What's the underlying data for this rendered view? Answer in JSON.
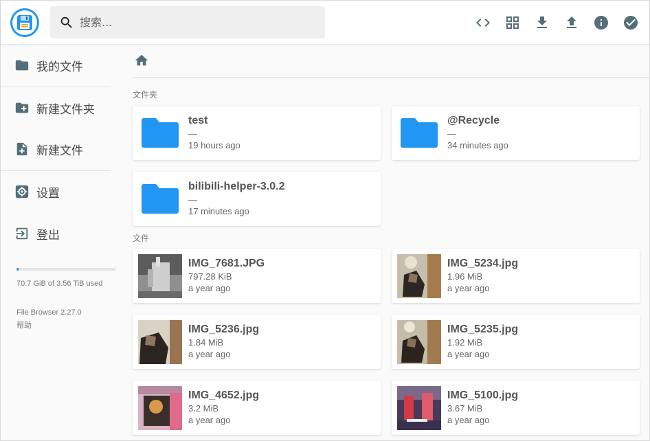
{
  "search": {
    "placeholder": "搜索..."
  },
  "header": {
    "actions": [
      {
        "icon": "code-icon"
      },
      {
        "icon": "grid-view-icon"
      },
      {
        "icon": "download-icon"
      },
      {
        "icon": "upload-icon"
      },
      {
        "icon": "info-icon"
      },
      {
        "icon": "check-circle-icon"
      }
    ]
  },
  "sidebar": {
    "items": [
      {
        "label": "我的文件",
        "icon": "folder-icon"
      },
      {
        "label": "新建文件夹",
        "icon": "create-folder-icon"
      },
      {
        "label": "新建文件",
        "icon": "note-add-icon"
      },
      {
        "label": "设置",
        "icon": "settings-icon"
      },
      {
        "label": "登出",
        "icon": "logout-icon"
      }
    ],
    "usage": {
      "text": "70.7 GiB of 3.56 TiB used",
      "fraction": 0.02
    },
    "version": "File Browser 2.27.0",
    "help": "帮助"
  },
  "main": {
    "folders_label": "文件夹",
    "files_label": "文件",
    "folders": [
      {
        "name": "test",
        "size": "—",
        "modified": "19 hours ago"
      },
      {
        "name": "@Recycle",
        "size": "—",
        "modified": "34 minutes ago"
      },
      {
        "name": "bilibili-helper-3.0.2",
        "size": "—",
        "modified": "17 minutes ago"
      }
    ],
    "files": [
      {
        "name": "IMG_7681.JPG",
        "size": "797.28 KiB",
        "modified": "a year ago"
      },
      {
        "name": "IMG_5234.jpg",
        "size": "1.96 MiB",
        "modified": "a year ago"
      },
      {
        "name": "IMG_5236.jpg",
        "size": "1.84 MiB",
        "modified": "a year ago"
      },
      {
        "name": "IMG_5235.jpg",
        "size": "1.92 MiB",
        "modified": "a year ago"
      },
      {
        "name": "IMG_4652.jpg",
        "size": "3.2 MiB",
        "modified": "a year ago"
      },
      {
        "name": "IMG_5100.jpg",
        "size": "3.67 MiB",
        "modified": "a year ago"
      }
    ]
  },
  "colors": {
    "accent": "#2196f3",
    "icon": "#546e7a",
    "folder": "#2196f3"
  }
}
